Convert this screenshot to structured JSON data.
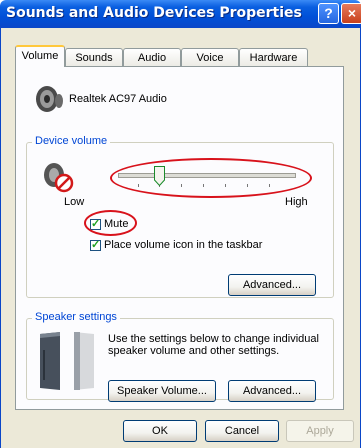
{
  "window": {
    "title": "Sounds and Audio Devices Properties",
    "help_glyph": "?",
    "close_glyph": "×"
  },
  "tabs": [
    {
      "label": "Volume",
      "active": true
    },
    {
      "label": "Sounds",
      "active": false
    },
    {
      "label": "Audio",
      "active": false
    },
    {
      "label": "Voice",
      "active": false
    },
    {
      "label": "Hardware",
      "active": false
    }
  ],
  "volume_tab": {
    "device_name": "Realtek AC97 Audio",
    "device_volume": {
      "group_title": "Device volume",
      "low_label": "Low",
      "high_label": "High",
      "slider_level": 0.22,
      "mute": {
        "label": "Mute",
        "checked": true
      },
      "taskbar_icon": {
        "label": "Place volume icon in the taskbar",
        "checked": true
      },
      "advanced_label": "Advanced..."
    },
    "speaker_settings": {
      "group_title": "Speaker settings",
      "description": "Use the settings below to change individual speaker volume and other settings.",
      "speaker_volume_label": "Speaker Volume...",
      "advanced_label": "Advanced..."
    }
  },
  "footer": {
    "ok_label": "OK",
    "cancel_label": "Cancel",
    "apply_label": "Apply"
  },
  "colors": {
    "title_bar": "#0054e3",
    "group_title": "#0046d5",
    "highlight_oval": "#d8121b",
    "tab_accent": "#ffc83c"
  }
}
